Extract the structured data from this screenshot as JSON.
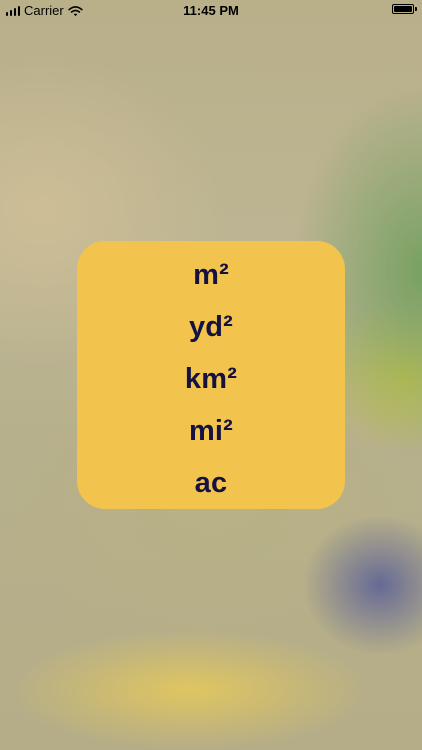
{
  "status_bar": {
    "carrier": "Carrier",
    "time": "11:45 PM"
  },
  "icons": {
    "signal": "signal-icon",
    "wifi": "wifi-icon",
    "battery": "battery-icon"
  },
  "colors": {
    "panel": "#f2c44e",
    "unit_text": "#15123f"
  },
  "units": [
    {
      "label": "m²"
    },
    {
      "label": "yd²"
    },
    {
      "label": "km²"
    },
    {
      "label": "mi²"
    },
    {
      "label": "ac"
    }
  ]
}
